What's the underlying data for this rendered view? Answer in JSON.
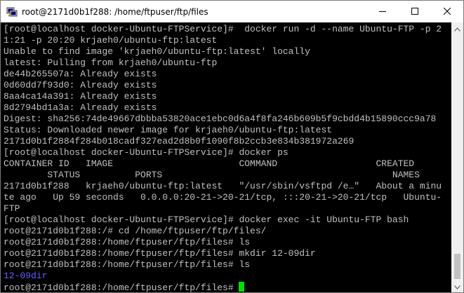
{
  "window": {
    "title": "root@2171d0b1f288: /home/ftpuser/ftp/files",
    "icon": "putty-terminal-icon",
    "controls": {
      "minimize": "minimize-icon",
      "maximize": "maximize-icon",
      "close": "close-icon"
    }
  },
  "terminal": {
    "colors": {
      "background": "#000000",
      "text": "#c0c0c0",
      "directory": "#5f5fff",
      "cursor": "#00e000"
    },
    "lines": [
      "[root@localhost docker-Ubuntu-FTPService]#  docker run -d --name Ubuntu-FTP -p 2",
      "1:21 -p 20:20 krjaeh0/ubuntu-ftp:latest",
      "Unable to find image 'krjaeh0/ubuntu-ftp:latest' locally",
      "latest: Pulling from krjaeh0/ubuntu-ftp",
      "de44b265507a: Already exists",
      "0d60dd7f93d0: Already exists",
      "8aa4ca14a391: Already exists",
      "8d2794bd1a3a: Already exists",
      "Digest: sha256:74de49667dbbba53820ace1ebc0d6a4f8fa246b609b5f9cbdd4b15890ccc9a78",
      "Status: Downloaded newer image for krjaeh0/ubuntu-ftp:latest",
      "2171d0b1f2884f284b018cadf327ead2d8b0f1090f8b2ccb3e834b381972a269",
      "[root@localhost docker-Ubuntu-FTPService]# docker ps",
      "CONTAINER ID   IMAGE                       COMMAND                  CREATED",
      "        STATUS          PORTS                                          NAMES",
      "2171d0b1f288   krjaeh0/ubuntu-ftp:latest   \"/usr/sbin/vsftpd /e…\"   About a minu",
      "te ago   Up 59 seconds   0.0.0.0:20-21->20-21/tcp, :::20-21->20-21/tcp   Ubuntu-",
      "FTP",
      "[root@localhost docker-Ubuntu-FTPService]# docker exec -it Ubuntu-FTP bash",
      "root@2171d0b1f288:/# cd /home/ftpuser/ftp/files/",
      "root@2171d0b1f288:/home/ftpuser/ftp/files# ls",
      "root@2171d0b1f288:/home/ftpuser/ftp/files# mkdir 12-09dir",
      "root@2171d0b1f288:/home/ftpuser/ftp/files# ls",
      "12-09dir",
      "root@2171d0b1f288:/home/ftpuser/ftp/files# "
    ]
  },
  "scrollbar": {
    "up": "scroll-up-arrow-icon",
    "down": "scroll-down-arrow-icon",
    "position": 1.0
  }
}
